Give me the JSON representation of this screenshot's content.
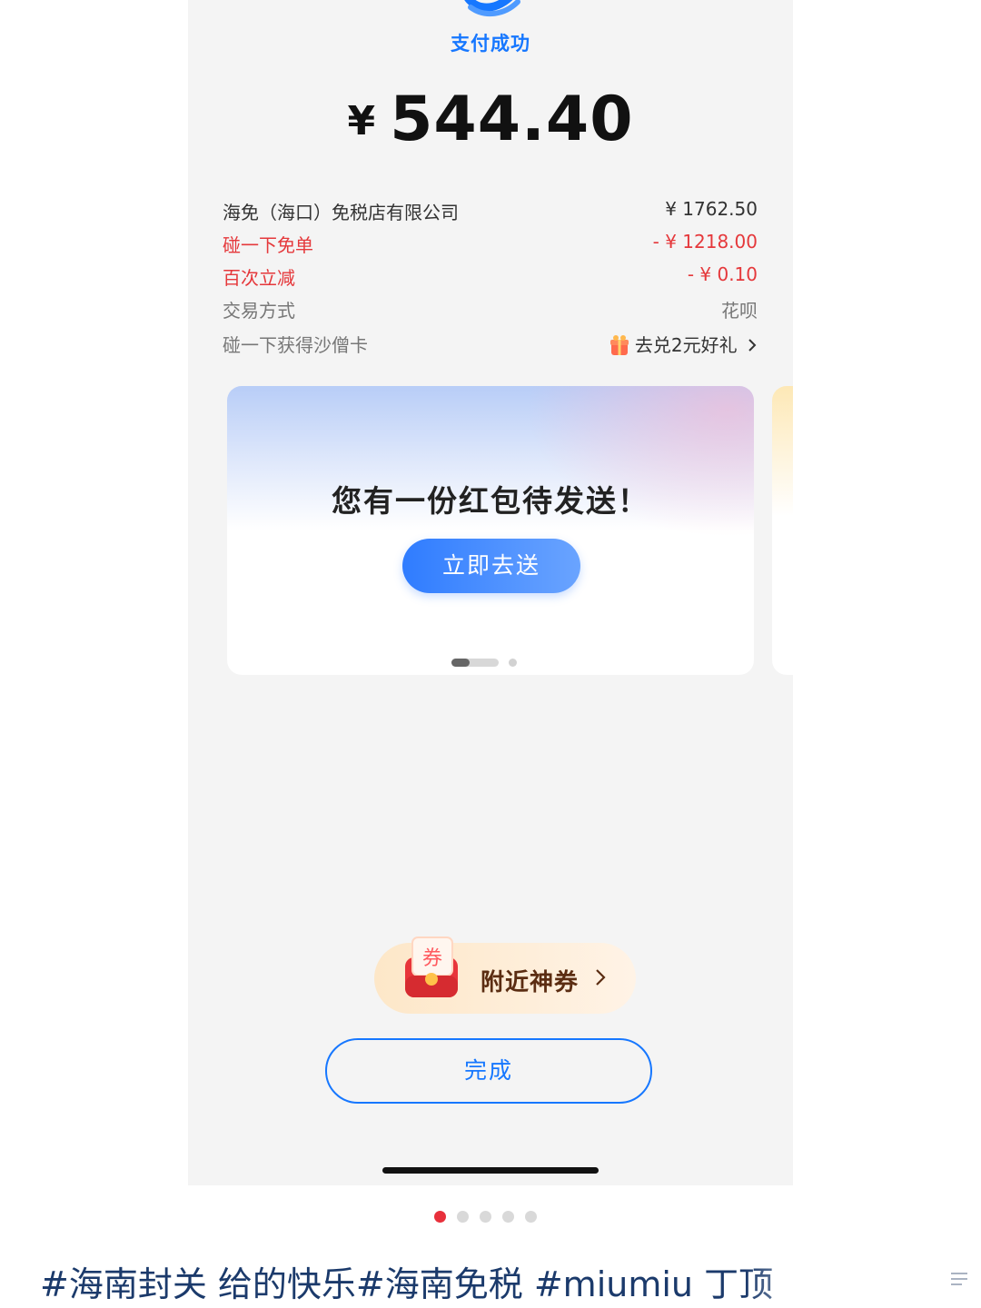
{
  "status": {
    "success_text": "支付成功"
  },
  "amount": {
    "currency": "¥",
    "value": "544.40"
  },
  "details": {
    "merchant_label": "海免（海口）免税店有限公司",
    "merchant_amount": "¥ 1762.50",
    "discount1_label": "碰一下免单",
    "discount1_amount": "- ¥ 1218.00",
    "discount2_label": "百次立减",
    "discount2_amount": "- ¥ 0.10",
    "payment_method_label": "交易方式",
    "payment_method_value": "花呗",
    "card_label": "碰一下获得沙僧卡",
    "card_link": "去兑2元好礼"
  },
  "promo_card": {
    "title": "您有一份红包待发送！",
    "button": "立即去送",
    "page": 1,
    "pages": 2
  },
  "coupon": {
    "label": "附近神券",
    "icon_text": "券"
  },
  "done_button": "完成",
  "image_pager": {
    "current": 1,
    "total": 5
  },
  "caption": "#海南封关 给的快乐#海南免税 #miumiu 丁顶",
  "colors": {
    "accent": "#1677ff",
    "discount_red": "#e5383b",
    "pager_active": "#e8303b"
  },
  "icons": [
    "alipay-success-icon",
    "gift-icon",
    "chevron-right-icon",
    "coupon-icon",
    "collapse-icon"
  ]
}
